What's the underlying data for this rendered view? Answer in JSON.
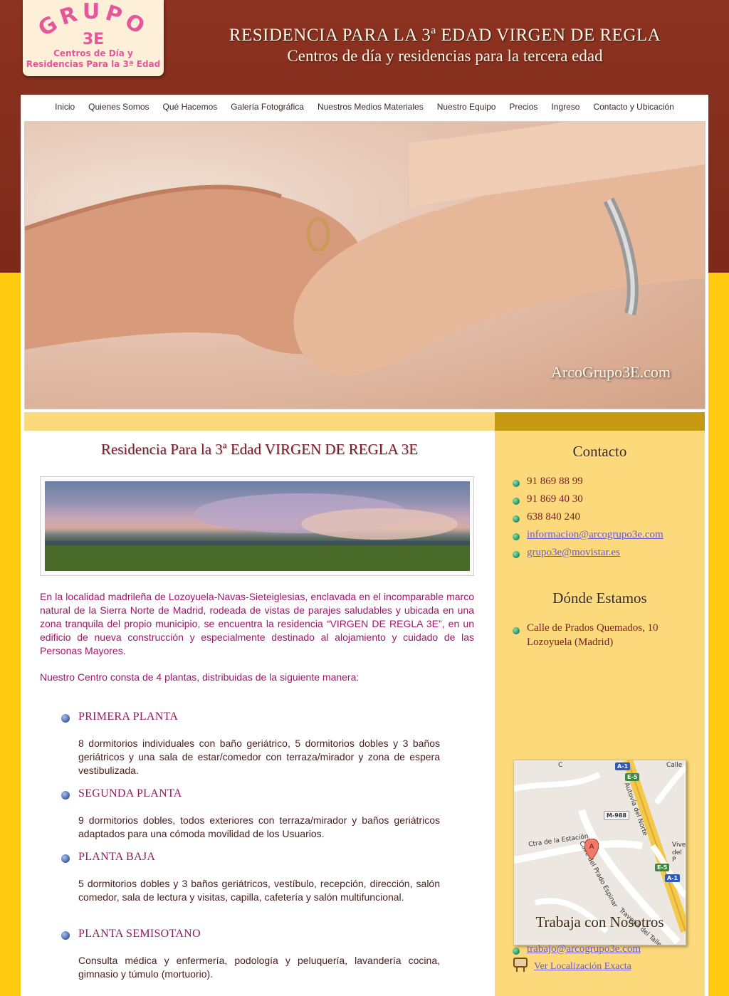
{
  "logo": {
    "wordmark": "GRUPO",
    "number": "3E",
    "subtitle_line1": "Centros de Día y",
    "subtitle_line2": "Residencias Para la 3ª Edad"
  },
  "header": {
    "title": "RESIDENCIA PARA LA 3ª EDAD  VIRGEN DE REGLA",
    "subtitle": "Centros de día y residencias para la tercera edad"
  },
  "nav": {
    "items": [
      {
        "label": "Inicio"
      },
      {
        "label": "Quienes Somos"
      },
      {
        "label": "Qué Hacemos"
      },
      {
        "label": "Galería Fotográfica"
      },
      {
        "label": "Nuestros Medios Materiales"
      },
      {
        "label": "Nuestro Equipo"
      },
      {
        "label": "Precios"
      },
      {
        "label": "Ingreso"
      },
      {
        "label": "Contacto y Ubicación"
      }
    ]
  },
  "hero": {
    "watermark": "ArcoGrupo3E.com"
  },
  "main": {
    "title": "Residencia Para la 3ª Edad VIRGEN DE REGLA 3E",
    "intro": "En la localidad madrileña de Lozoyuela-Navas-Sieteiglesias, enclavada en el incomparable marco natural de la Sierra Norte de Madrid, rodeada de vistas de parajes saludables y ubicada en una zona tranquila del propio municipio, se encuentra la residencia “VIRGEN DE REGLA 3E”, en un edificio de nueva construcción y especialmente destinado al alojamiento y cuidado de las Personas Mayores.",
    "floors_intro": "Nuestro Centro consta de 4 plantas, distribuidas de la siguiente manera:",
    "sections": [
      {
        "heading": "PRIMERA PLANTA",
        "body": "8 dormitorios individuales con baño geriátrico, 5 dormitorios dobles y 3 baños geriátricos y una sala de estar/comedor con terraza/mirador y zona de espera vestibulizada."
      },
      {
        "heading": "SEGUNDA PLANTA",
        "body": "9 dormitorios dobles, todos exteriores con terraza/mirador y baños geriátricos adaptados para una cómoda movilidad de los Usuarios."
      },
      {
        "heading": "PLANTA BAJA",
        "body": "5 dormitorios dobles y 3 baños geriátricos, vestíbulo, recepción, dirección, salón comedor, sala de lectura y visitas, capilla, cafetería y salón multifuncional."
      },
      {
        "heading": "PLANTA SEMISOTANO",
        "body": "Consulta médica y enfermería, podología y peluquería, lavandería cocina, gimnasio y túmulo (mortuorio)."
      }
    ]
  },
  "sidebar": {
    "contact_title": "Contacto",
    "phones": [
      "91 869 88 99",
      "91 869 40 30",
      "638 840 240"
    ],
    "emails": [
      "informacion@arcogrupo3e.com",
      "grupo3e@movistar.es"
    ],
    "location_title": "Dónde Estamos",
    "address_line1": "Calle de Prados Quemados, 10",
    "address_line2": "Lozoyuela (Madrid)",
    "map": {
      "labels": [
        "Ctra de la Estación",
        "Calle del Prado Espinar",
        "Autovía del Norte",
        "Travesía del Taller",
        "Vive",
        "del P",
        "Calle",
        "C"
      ],
      "shields": [
        "A-1",
        "E-5",
        "M-988",
        "E-5",
        "A-1"
      ],
      "marker": "A"
    },
    "map_link": "Ver Localización Exacta",
    "jobs_title": "Trabaja con Nosotros",
    "jobs_email": "trabajo@arcogrupo3e.com"
  },
  "colors": {
    "header_bg": "#8c3220",
    "page_bg": "#ffcc11",
    "sidebar_bg": "#fcd97a",
    "heading_red": "#7a1d2a",
    "body_magenta": "#a0156b",
    "logo_pink": "#e6569a"
  }
}
